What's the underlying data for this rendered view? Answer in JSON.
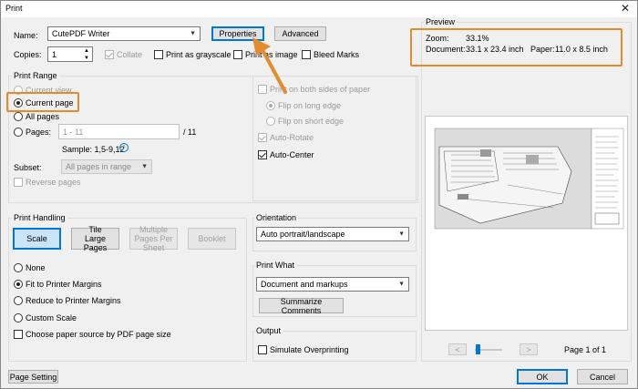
{
  "window": {
    "title": "Print",
    "close_glyph": "✕"
  },
  "printer": {
    "name_label": "Name:",
    "name_value": "CutePDF Writer",
    "properties_label": "Properties",
    "advanced_label": "Advanced",
    "copies_label": "Copies:",
    "copies_value": "1",
    "collate_label": "Collate",
    "grayscale_label": "Print as grayscale",
    "print_as_image_label": "Print as image",
    "bleed_marks_label": "Bleed Marks"
  },
  "print_range": {
    "title": "Print Range",
    "current_view": "Current view",
    "current_page": "Current page",
    "all_pages": "All pages",
    "pages_label": "Pages:",
    "pages_placeholder": "1 - 11",
    "pages_total": "/ 11",
    "sample": "Sample: 1,5-9,12",
    "subset_label": "Subset:",
    "subset_value": "All pages in range",
    "reverse_pages": "Reverse pages"
  },
  "duplex": {
    "both_sides": "Print on both sides of paper",
    "flip_long": "Flip on long edge",
    "flip_short": "Flip on short edge",
    "auto_rotate": "Auto-Rotate",
    "auto_center": "Auto-Center"
  },
  "print_handling": {
    "title": "Print Handling",
    "scale": "Scale",
    "tile_large": "Tile Large Pages",
    "multiple_pages": "Multiple Pages Per Sheet",
    "booklet": "Booklet",
    "none": "None",
    "fit_margins": "Fit to Printer Margins",
    "reduce_margins": "Reduce to Printer Margins",
    "custom_scale": "Custom Scale",
    "choose_source": "Choose paper source by PDF page size"
  },
  "orientation": {
    "title": "Orientation",
    "value": "Auto portrait/landscape"
  },
  "print_what": {
    "title": "Print What",
    "value": "Document and markups",
    "summarize": "Summarize Comments"
  },
  "output": {
    "title": "Output",
    "simulate": "Simulate Overprinting"
  },
  "preview": {
    "title": "Preview",
    "zoom_label": "Zoom:",
    "zoom_value": "33.1%",
    "document_label": "Document:",
    "document_value": "33.1 x 23.4 inch",
    "paper_label": "Paper:",
    "paper_value": "11.0 x 8.5 inch",
    "page_indicator": "Page 1 of 1",
    "prev_glyph": "<",
    "next_glyph": ">"
  },
  "footer": {
    "page_setting": "Page Setting",
    "ok": "OK",
    "cancel": "Cancel"
  },
  "colors": {
    "accent": "#0078d7",
    "highlight": "#e68a2e"
  }
}
